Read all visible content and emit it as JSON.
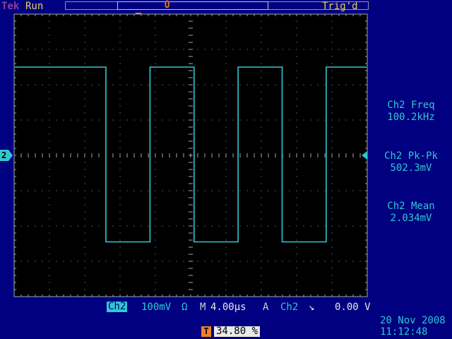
{
  "header": {
    "brand": "Tek",
    "run_status": "Run",
    "trigger_status": "Trig'd"
  },
  "colors": {
    "background": "#000080",
    "trace": "#30c8d0",
    "status_text": "#e8d060",
    "trigger_marker": "#f08020",
    "graticule": "#9aa8b4"
  },
  "icons": {
    "record_trigger": "trigger-position-icon",
    "trigger_position": "trigger-T-icon",
    "channel_ground": "ch2-ground-arrow-icon",
    "trigger_level": "trigger-level-arrow-icon",
    "slope": "falling-edge-icon"
  },
  "channel_marker": "2",
  "measurements": [
    {
      "label": "Ch2 Freq",
      "value": "100.2kHz"
    },
    {
      "label": "Ch2 Pk-Pk",
      "value": "502.3mV"
    },
    {
      "label": "Ch2 Mean",
      "value": "2.034mV"
    }
  ],
  "bottom": {
    "channel": "Ch2",
    "volts_per_div": "100mV",
    "coupling_symbol": "Ω",
    "timebase_prefix": "M",
    "time_per_div": "4.00µs",
    "trigger_mode": "A",
    "trigger_source": "Ch2",
    "slope_symbol": "↘",
    "trigger_level": "0.00 V",
    "trigger_position_label": "T",
    "trigger_position_value": "34.80 %",
    "date": "20 Nov 2008",
    "time": "11:12:48"
  },
  "waveform": {
    "type": "square",
    "volts_per_div": 0.1,
    "time_per_div_us": 4.0,
    "high_v": 0.25,
    "low_v": -0.245,
    "period_us": 9.98,
    "first_falling_edge_us": 10.4
  }
}
